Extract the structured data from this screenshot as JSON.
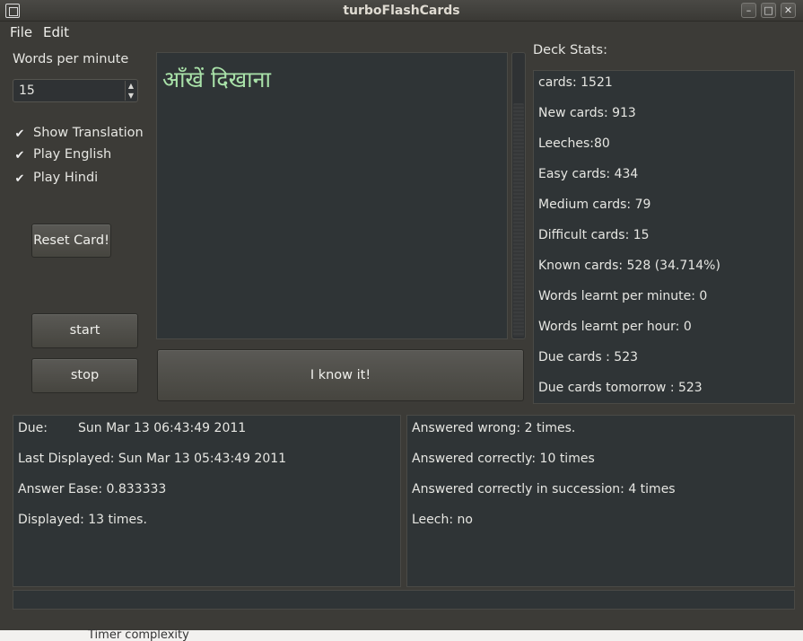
{
  "window": {
    "title": "turboFlashCards"
  },
  "menu": {
    "file": "File",
    "edit": "Edit"
  },
  "controls": {
    "wpm_label": "Words per minute",
    "wpm_value": "15",
    "show_translation": "Show Translation",
    "play_english": "Play English",
    "play_hindi": "Play Hindi",
    "reset_card": "Reset Card!",
    "start": "start",
    "stop": "stop",
    "i_know_it": "I know it!"
  },
  "card": {
    "text": "आँखें दिखाना"
  },
  "deck_stats": {
    "heading": "Deck Stats:",
    "items": [
      "cards: 1521",
      "New cards: 913",
      "Leeches:80",
      "Easy cards: 434",
      "Medium cards: 79",
      "Difficult cards: 15",
      "Known cards: 528 (34.714%)",
      "Words learnt per minute: 0",
      "Words learnt per hour: 0",
      "Due cards : 523",
      "Due cards tomorrow : 523"
    ]
  },
  "card_info_left": {
    "due_label": "Due:",
    "due_value": "Sun Mar 13 06:43:49 2011",
    "last_displayed": "Last Displayed: Sun Mar 13 05:43:49 2011",
    "answer_ease": "Answer Ease: 0.833333",
    "displayed": "Displayed: 13 times."
  },
  "card_info_right": {
    "wrong": "Answered wrong: 2 times.",
    "correct": "Answered correctly: 10 times",
    "succession": "Answered correctly in succession: 4 times",
    "leech": "Leech: no"
  },
  "background_text": "Timer complexity",
  "icons": {
    "window": "app-window-icon",
    "minimize": "minimize-icon",
    "maximize": "maximize-icon",
    "close": "close-icon",
    "check": "checkmark-icon",
    "spin_up": "arrow-up-icon",
    "spin_down": "arrow-down-icon"
  },
  "colors": {
    "card_text": "#a9e2a9",
    "panel_bg": "#2f3436",
    "window_bg": "#3c3b37"
  }
}
